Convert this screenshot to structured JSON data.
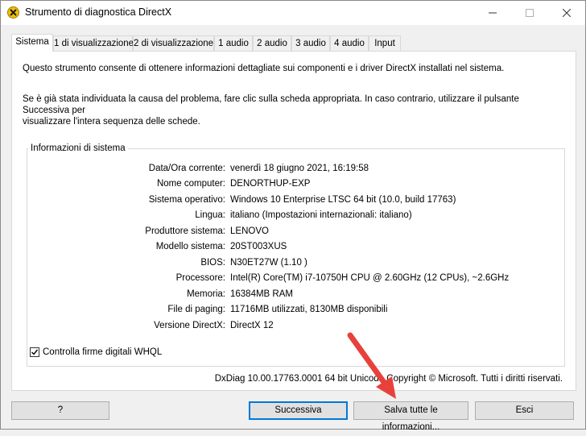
{
  "window": {
    "title": "Strumento di diagnostica DirectX",
    "icon": "directx-icon"
  },
  "tabs": [
    {
      "label": "Sistema",
      "active": true
    },
    {
      "label": "1 di visualizzazione",
      "active": false
    },
    {
      "label": "2 di visualizzazione",
      "active": false
    },
    {
      "label": "1 audio",
      "active": false
    },
    {
      "label": "2 audio",
      "active": false
    },
    {
      "label": "3 audio",
      "active": false
    },
    {
      "label": "4 audio",
      "active": false
    },
    {
      "label": "Input",
      "active": false
    }
  ],
  "intro": {
    "p1": "Questo strumento consente di ottenere informazioni dettagliate sui componenti e i driver DirectX installati nel sistema.",
    "p2_line1": "Se è già stata individuata la causa del problema, fare clic sulla scheda appropriata. In caso contrario, utilizzare il pulsante Successiva per",
    "p2_line2": "visualizzare l'intera sequenza delle schede."
  },
  "system_info": {
    "legend": "Informazioni di sistema",
    "rows": [
      {
        "label": "Data/Ora corrente:",
        "value": "venerdì 18 giugno 2021, 16:19:58"
      },
      {
        "label": "Nome computer:",
        "value": "DENORTHUP-EXP"
      },
      {
        "label": "Sistema operativo:",
        "value": "Windows 10 Enterprise LTSC 64 bit (10.0, build 17763)"
      },
      {
        "label": "Lingua:",
        "value": "italiano (Impostazioni internazionali: italiano)"
      },
      {
        "label": "Produttore sistema:",
        "value": "LENOVO"
      },
      {
        "label": "Modello sistema:",
        "value": "20ST003XUS"
      },
      {
        "label": "BIOS:",
        "value": "N30ET27W (1.10 )"
      },
      {
        "label": "Processore:",
        "value": "Intel(R) Core(TM) i7-10750H CPU @ 2.60GHz (12 CPUs), ~2.6GHz"
      },
      {
        "label": "Memoria:",
        "value": "16384MB RAM"
      },
      {
        "label": "File di paging:",
        "value": "11716MB utilizzati, 8130MB disponibili"
      },
      {
        "label": "Versione DirectX:",
        "value": "DirectX 12"
      }
    ]
  },
  "whql": {
    "label": "Controlla firme digitali WHQL",
    "checked": true
  },
  "copyright": "DxDiag 10.00.17763.0001 64 bit Unicode Copyright © Microsoft. Tutti i diritti riservati.",
  "buttons": {
    "help": "?",
    "next": "Successiva",
    "save_all": "Salva tutte le informazioni...",
    "exit": "Esci"
  },
  "colors": {
    "accent": "#0078d7",
    "annotation_arrow": "#e8413c"
  }
}
